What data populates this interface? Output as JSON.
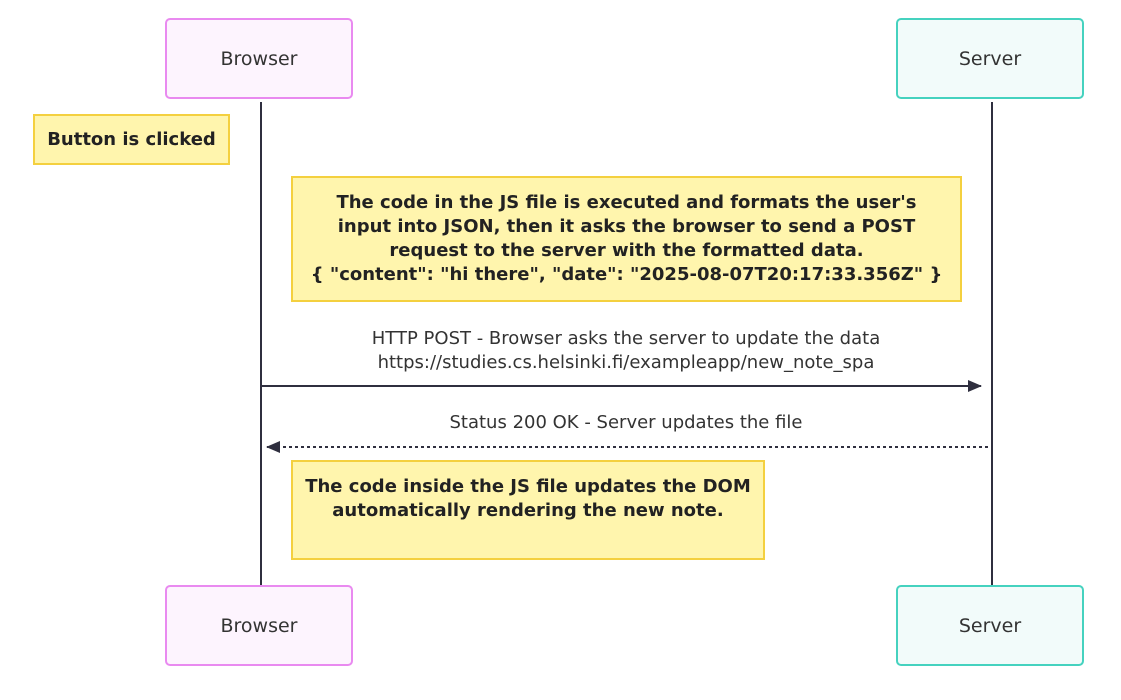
{
  "participants": {
    "browser": "Browser",
    "server": "Server"
  },
  "notes": {
    "button_clicked": "Button is clicked",
    "js_execute": [
      "The code in the JS file is executed and formats the user's",
      "input into JSON, then it asks the browser to send a POST",
      "request to the server with the formatted data.",
      "{ \"content\": \"hi there\", \"date\": \"2025-08-07T20:17:33.356Z\" }"
    ],
    "dom_update": [
      "The code inside the JS file updates the DOM",
      "automatically rendering the new note."
    ]
  },
  "messages": {
    "post": [
      "HTTP POST - Browser asks the server to update the data",
      "https://studies.cs.helsinki.fi/exampleapp/new_note_spa"
    ],
    "response": "Status 200 OK - Server updates the file"
  },
  "colors": {
    "browser_border": "#e98af0",
    "server_border": "#45d2bf",
    "note_fill": "#fff5ad",
    "note_border": "#f4d03f",
    "line": "#2f2f3f"
  }
}
